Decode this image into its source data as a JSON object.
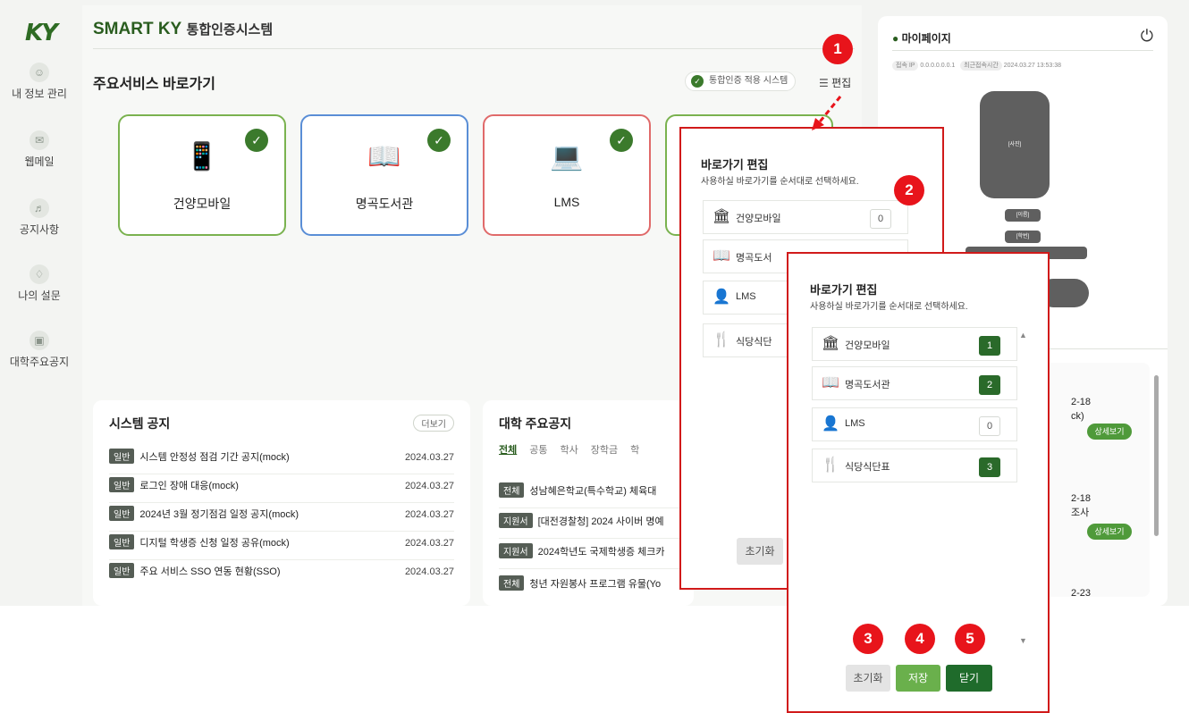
{
  "sidebar": {
    "logo": "KY",
    "items": [
      {
        "label": "내 정보 관리"
      },
      {
        "label": "웹메일"
      },
      {
        "label": "공지사항"
      },
      {
        "label": "나의 설문"
      },
      {
        "label": "대학주요공지"
      }
    ]
  },
  "header": {
    "title_brand": "SMART KY",
    "title_rest": "통합인증시스템"
  },
  "shortcuts": {
    "title": "주요서비스 바로가기",
    "sso_badge": "통합인증 적용 시스템",
    "edit_label": "편집",
    "cards": [
      {
        "name": "건양모바일",
        "border": "#7ab24f"
      },
      {
        "name": "명곡도서관",
        "border": "#5a8ed6"
      },
      {
        "name": "LMS",
        "border": "#e06a6a"
      }
    ]
  },
  "system_notice": {
    "title": "시스템 공지",
    "more": "더보기",
    "rows": [
      {
        "tag": "일반",
        "text": "시스템 안정성 점검 기간 공지(mock)",
        "date": "2024.03.27"
      },
      {
        "tag": "일반",
        "text": "로그인 장애 대응(mock)",
        "date": "2024.03.27"
      },
      {
        "tag": "일반",
        "text": "2024년 3월 정기점검 일정 공지(mock)",
        "date": "2024.03.27"
      },
      {
        "tag": "일반",
        "text": "디지털 학생증 신청 일정 공유(mock)",
        "date": "2024.03.27"
      },
      {
        "tag": "일반",
        "text": "주요 서비스 SSO 연동 현황(SSO)",
        "date": "2024.03.27"
      }
    ]
  },
  "univ_notice": {
    "title": "대학 주요공지",
    "tabs": [
      "전체",
      "공통",
      "학사",
      "장학금",
      "학"
    ],
    "rows": [
      {
        "tag": "전체",
        "text": "성남혜은학교(특수학교) 체육대"
      },
      {
        "tag": "지원서",
        "text": "[대전경찰청] 2024 사이버 명예"
      },
      {
        "tag": "지원서",
        "text": "2024학년도 국제학생증 체크카"
      },
      {
        "tag": "전체",
        "text": "청년 자원봉사 프로그램 유물(Yo"
      }
    ]
  },
  "mypage": {
    "title": "마이페이지",
    "ip_label": "접속 IP",
    "ip_value": "0.0.0.0.0.0.1",
    "last_label": "최근접속시간",
    "last_value": "2024.03.27 13:53:38",
    "photo_label": "[사진]",
    "name_label": "[이름]",
    "id_label": "[학번]",
    "list": [
      {
        "date": "2-18",
        "extra": "ck)",
        "btn": "상세보기"
      },
      {
        "date": "2-18",
        "extra": "조사",
        "btn": "상세보기"
      },
      {
        "date": "2-23",
        "extra": "",
        "btn": ""
      }
    ]
  },
  "modal1": {
    "title": "바로가기 편집",
    "sub": "사용하실 바로가기를 순서대로 선택하세요.",
    "items": [
      {
        "label": "건양모바일",
        "num": "0"
      },
      {
        "label": "명곡도서",
        "num": ""
      },
      {
        "label": "LMS",
        "num": ""
      },
      {
        "label": "식당식단",
        "num": ""
      }
    ],
    "reset": "초기화"
  },
  "modal2": {
    "title": "바로가기 편집",
    "sub": "사용하실 바로가기를 순서대로 선택하세요.",
    "items": [
      {
        "label": "건양모바일",
        "num": "1"
      },
      {
        "label": "명곡도서관",
        "num": "2"
      },
      {
        "label": "LMS",
        "num": "0"
      },
      {
        "label": "식당식단표",
        "num": "3"
      }
    ],
    "reset": "초기화",
    "save": "저장",
    "close": "닫기"
  },
  "callouts": [
    "1",
    "2",
    "3",
    "4",
    "5"
  ],
  "colors": {
    "brand": "#2a5d1f",
    "accent": "#3b7a2c",
    "callout": "#e8141b"
  }
}
